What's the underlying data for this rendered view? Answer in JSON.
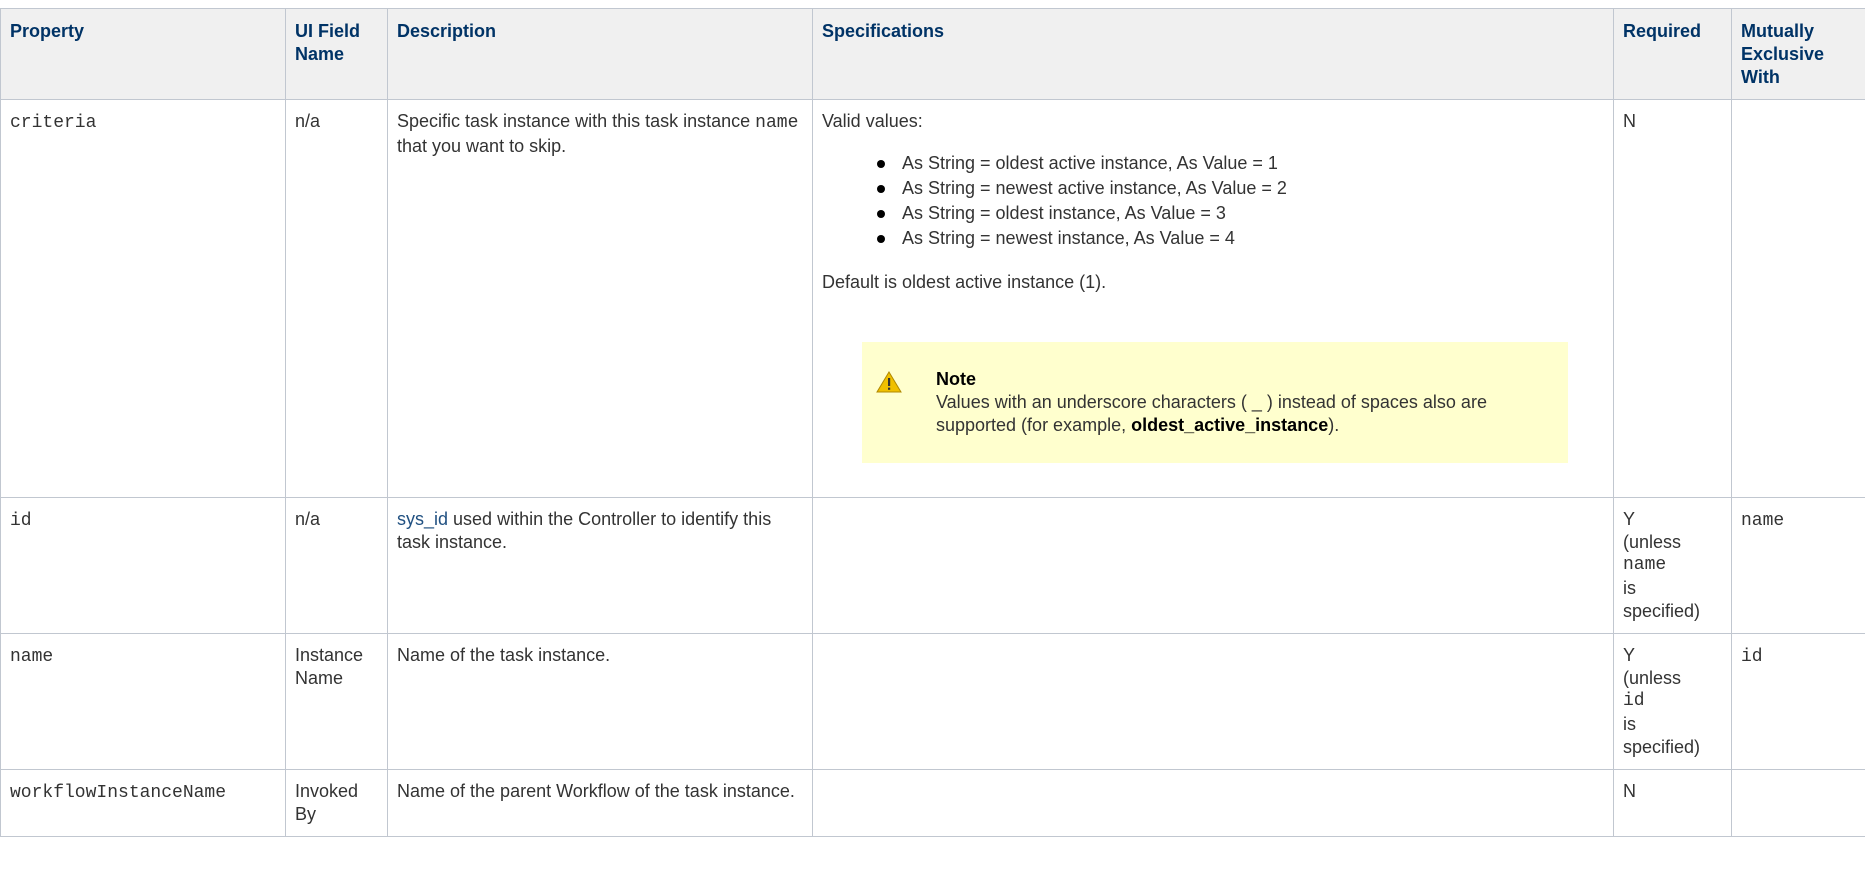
{
  "headers": [
    "Property",
    "UI Field Name",
    "Description",
    "Specifications",
    "Required",
    "Mutually Exclusive With"
  ],
  "rows": {
    "criteria": {
      "property": "criteria",
      "ui_field": "n/a",
      "desc_a": "Specific task instance with this task instance ",
      "desc_code": "name",
      "desc_b": " that you want to skip.",
      "spec_intro": "Valid values:",
      "spec_items": [
        "As String = oldest active instance, As Value = 1",
        "As String = newest active instance, As Value = 2",
        "As String = oldest instance, As Value = 3",
        "As String = newest instance, As Value = 4"
      ],
      "spec_default": "Default is oldest active instance (1).",
      "note": {
        "title": "Note",
        "body_a": "Values with an underscore characters ( _ ) instead of spaces also are supported (for example, ",
        "body_bold": "oldest_active_instance",
        "body_b": ")."
      },
      "required": "N",
      "exclusive": ""
    },
    "id": {
      "property": "id",
      "ui_field": "n/a",
      "desc_link": "sys_id",
      "desc_rest": " used within the Controller to identify this task instance.",
      "req_a": "Y",
      "req_b": "(unless",
      "req_code": "name",
      "req_c": "is",
      "req_d": "specified)",
      "exclusive": "name"
    },
    "name": {
      "property": "name",
      "ui_field": "Instance Name",
      "desc": "Name of the task instance.",
      "req_a": "Y",
      "req_b": "(unless",
      "req_code": "id",
      "req_c": "is",
      "req_d": "specified)",
      "exclusive": "id"
    },
    "workflow": {
      "property": "workflowInstanceName",
      "ui_field": "Invoked By",
      "desc": "Name of the parent Workflow of the task instance.",
      "required": "N"
    }
  },
  "colors": {
    "header_text": "#003366",
    "header_bg": "#f0f0f0",
    "link": "#205081",
    "note_bg": "#ffffce",
    "warn_icon": "#f0c000"
  },
  "icons": {
    "note": "warning-icon"
  }
}
